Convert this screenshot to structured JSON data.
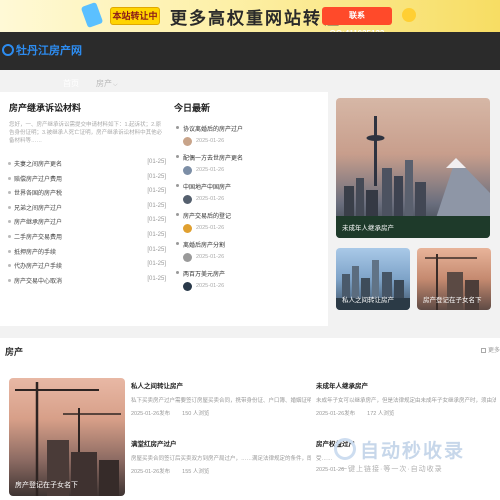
{
  "banner": {
    "tag": "本站转让中",
    "slogan": "更多高权重网站转让",
    "contact": "联系QQ:411025133"
  },
  "nav": {
    "logo": "牡丹江房产网",
    "home": "首页",
    "category": "房产",
    "category_caret": "⌵"
  },
  "left": {
    "title": "房产继承诉讼材料",
    "desc": "您好，一、房产继承诉讼需提交申请材料如下：1.起诉状；2.原告身份证明；3.被继承人死亡证明，房产继承诉讼材料中其他必备材料等……",
    "items": [
      {
        "title": "夫妻之间房产更名",
        "date": "[01-25]"
      },
      {
        "title": "赔偿房产过户费用",
        "date": "[01-25]"
      },
      {
        "title": "世界各国的房产税",
        "date": "[01-25]"
      },
      {
        "title": "兄弟之间房产过户",
        "date": "[01-25]"
      },
      {
        "title": "房产继承房产过户",
        "date": "[01-25]"
      },
      {
        "title": "二手房产交易费用",
        "date": "[01-25]"
      },
      {
        "title": "抵押房产的手续",
        "date": "[01-25]"
      },
      {
        "title": "代办房产过户手续",
        "date": "[01-25]"
      },
      {
        "title": "房产交易中心取消",
        "date": "[01-25]"
      }
    ]
  },
  "today": {
    "title": "今日最新",
    "items": [
      {
        "title": "协议离婚后的房产过户",
        "date": "2025-01-26"
      },
      {
        "title": "配偶一方去世房产更名",
        "date": "2025-01-26"
      },
      {
        "title": "中国地产中国房产",
        "date": "2025-01-26"
      },
      {
        "title": "房产交易后的登记",
        "date": "2025-01-26"
      },
      {
        "title": "离婚后房产分割",
        "date": "2025-01-26"
      },
      {
        "title": "两百万美元房产",
        "date": "2025-01-26"
      }
    ]
  },
  "feature": {
    "hero_caption": "未成年人继承房产",
    "side1_caption": "私人之间转让房产",
    "side2_caption": "房产登记在子女名下",
    "chevron": "›"
  },
  "section": {
    "title": "房产",
    "more": "更多"
  },
  "bottom": {
    "big_caption": "房产登记在子女名下",
    "articles": [
      {
        "title": "私人之间转让房产",
        "summary": "私下买卖房产过户需要签订房屋买卖合同，携带身份证、户口簿、婚姻证明、房……",
        "date": "2025-01-26发布",
        "views": "150 人浏览"
      },
      {
        "title": "未成年人继承房产",
        "summary": "未成年子女可以继承房产，但是法律规定由未成年子女继承房产时，须由法定代……",
        "date": "2025-01-26发布",
        "views": "172 人浏览"
      },
      {
        "title": "满堂红房产过户",
        "summary": "房屋买卖合同签订后买卖双方到房产局过户，……满足法律规定的条件，即可办理……",
        "date": "2025-01-26发布",
        "views": "155 人浏览"
      },
      {
        "title": "房产权益过户",
        "summary": "受……",
        "date": "2025-01-26",
        "views": ""
      }
    ]
  },
  "watermark": {
    "text": "自动秒收录",
    "sub": "一键上链接·等一次·自动收录"
  },
  "colors": {
    "nav_bg": "#2b2b2b",
    "accent": "#2d8cf0"
  }
}
